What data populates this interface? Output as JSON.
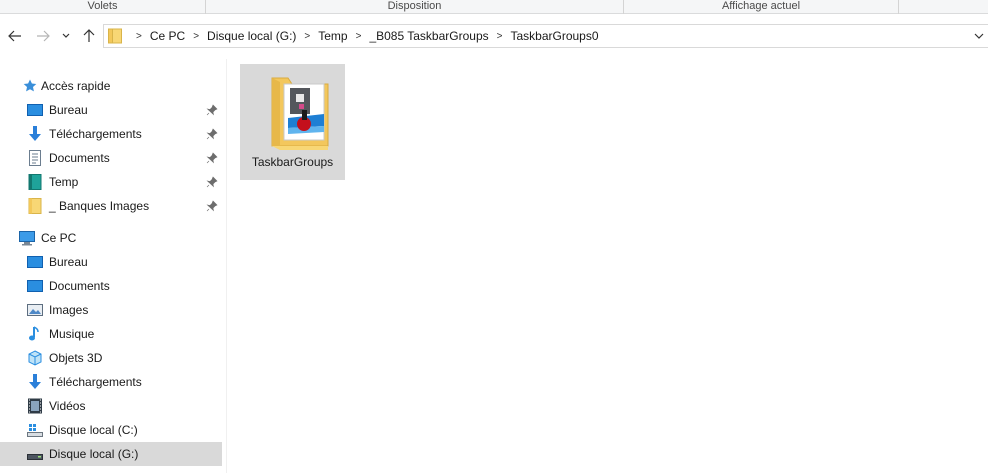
{
  "ribbon": {
    "groups": [
      "Volets",
      "Disposition",
      "Affichage actuel"
    ]
  },
  "address": {
    "crumbs": [
      "Ce PC",
      "Disque local (G:)",
      "Temp",
      "_B085 TaskbarGroups",
      "TaskbarGroups0"
    ]
  },
  "navpane": {
    "quick_access": "Accès rapide",
    "quick_items": [
      {
        "label": "Bureau",
        "icon": "desktop-icon"
      },
      {
        "label": "Téléchargements",
        "icon": "download-icon"
      },
      {
        "label": "Documents",
        "icon": "documents-icon"
      },
      {
        "label": "Temp",
        "icon": "folder-teal-icon"
      },
      {
        "label": "_ Banques Images",
        "icon": "folder-icon"
      }
    ],
    "this_pc": "Ce PC",
    "pc_items": [
      {
        "label": "Bureau",
        "icon": "desktop-icon"
      },
      {
        "label": "Documents",
        "icon": "documents-icon"
      },
      {
        "label": "Images",
        "icon": "pictures-icon"
      },
      {
        "label": "Musique",
        "icon": "music-icon"
      },
      {
        "label": "Objets 3D",
        "icon": "3d-objects-icon"
      },
      {
        "label": "Téléchargements",
        "icon": "download-icon"
      },
      {
        "label": "Vidéos",
        "icon": "videos-icon"
      },
      {
        "label": "Disque local (C:)",
        "icon": "windows-drive-icon"
      },
      {
        "label": "Disque local (G:)",
        "icon": "drive-icon"
      }
    ]
  },
  "content": {
    "items": [
      {
        "label": "TaskbarGroups",
        "icon": "taskbargroups-folder-icon"
      }
    ]
  },
  "colors": {
    "selection": "#d9d9d9",
    "accent": "#0078d7",
    "folder": "#f8d775"
  }
}
